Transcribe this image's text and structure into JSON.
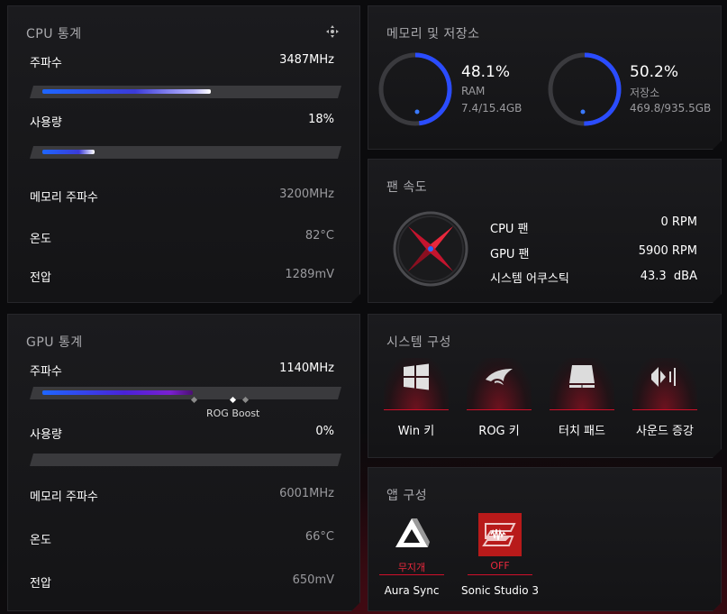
{
  "colors": {
    "accent_blue": "#2a5cff",
    "accent_red": "#e8283c",
    "panel_bg": "#18181b"
  },
  "cpu": {
    "title": "CPU 통계",
    "freq_label": "주파수",
    "freq_value": "3487MHz",
    "usage_label": "사용량",
    "usage_value": "18%",
    "mem_label": "메모리 주파수",
    "mem_value": "3200MHz",
    "temp_label": "온도",
    "temp_value": "82°C",
    "volt_label": "전압",
    "volt_value": "1289mV",
    "freq_fraction": 0.58,
    "usage_fraction": 0.18
  },
  "gpu": {
    "title": "GPU 통계",
    "freq_label": "주파수",
    "freq_value": "1140MHz",
    "boost_label": "ROG Boost",
    "usage_label": "사용량",
    "usage_value": "0%",
    "mem_label": "메모리 주파수",
    "mem_value": "6001MHz",
    "temp_label": "온도",
    "temp_value": "66°C",
    "volt_label": "전압",
    "volt_value": "650mV",
    "freq_fraction": 0.52,
    "usage_fraction": 0.0
  },
  "storage": {
    "title": "메모리 및 저장소",
    "ram": {
      "percent": "48.1%",
      "label": "RAM",
      "detail": "7.4/15.4GB",
      "fraction": 0.481
    },
    "disk": {
      "percent": "50.2%",
      "label": "저장소",
      "detail": "469.8/935.5GB",
      "fraction": 0.502
    }
  },
  "fan": {
    "title": "팬 속도",
    "cpu_label": "CPU 팬",
    "cpu_value": "0 RPM",
    "gpu_label": "GPU 팬",
    "gpu_value": "5900 RPM",
    "sys_label": "시스템 어쿠스틱",
    "sys_value": "43.3  dBA"
  },
  "system": {
    "title": "시스템 구성",
    "items": [
      {
        "label": "Win 키",
        "icon": "windows-icon"
      },
      {
        "label": "ROG 키",
        "icon": "rog-eye-icon"
      },
      {
        "label": "터치 패드",
        "icon": "touchpad-icon"
      },
      {
        "label": "사운드 증강",
        "icon": "sound-boost-icon"
      }
    ]
  },
  "apps": {
    "title": "앱 구성",
    "items": [
      {
        "name": "Aura Sync",
        "state": "무지개",
        "icon": "aura-sync-icon"
      },
      {
        "name": "Sonic Studio 3",
        "state": "OFF",
        "icon": "sonic-studio-icon"
      }
    ]
  }
}
